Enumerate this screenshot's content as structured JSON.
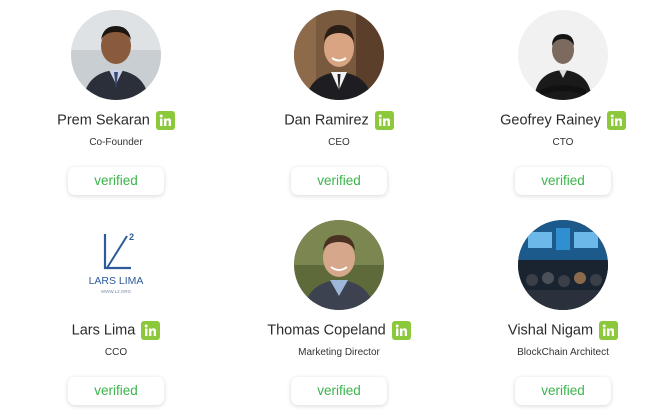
{
  "team": [
    {
      "name": "Prem Sekaran",
      "role": "Co-Founder",
      "verified": "verified"
    },
    {
      "name": "Dan Ramirez",
      "role": "CEO",
      "verified": "verified"
    },
    {
      "name": "Geofrey Rainey",
      "role": "CTO",
      "verified": "verified"
    },
    {
      "name": "Lars Lima",
      "role": "CCO",
      "verified": "verified",
      "logo_text": "LARS LIMA",
      "logo_sub": "WWW.L2.ORG"
    },
    {
      "name": "Thomas Copeland",
      "role": "Marketing Director",
      "verified": "verified"
    },
    {
      "name": "Vishal Nigam",
      "role": "BlockChain Architect",
      "verified": "verified"
    }
  ],
  "colors": {
    "linkedin_badge": "#8cc83c",
    "verified_text": "#3ab54a"
  },
  "icons": {
    "badge": "linkedin-icon"
  }
}
